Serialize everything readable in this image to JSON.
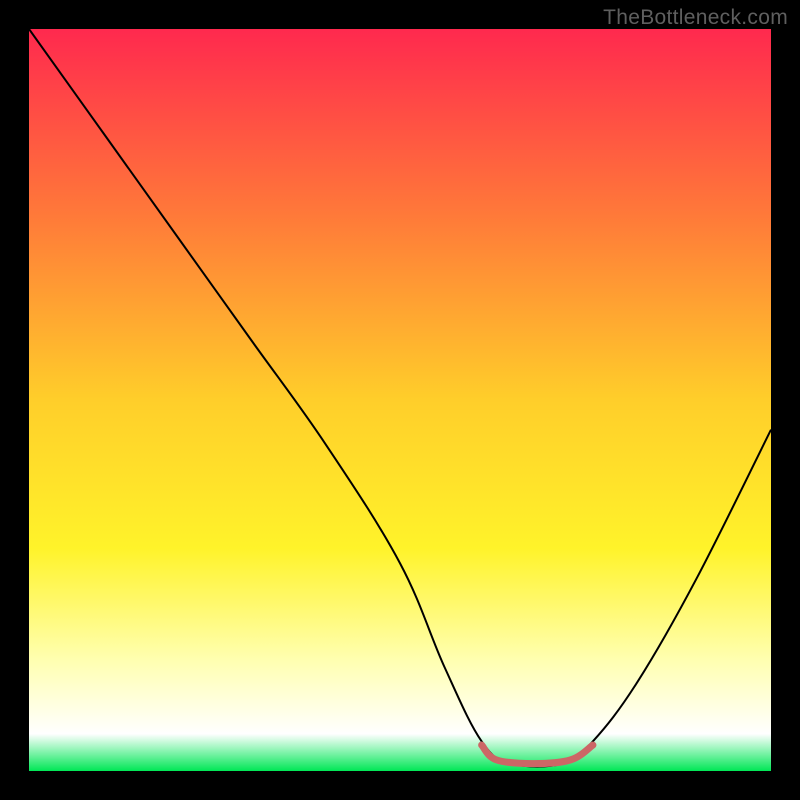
{
  "watermark": "TheBottleneck.com",
  "chart_data": {
    "type": "line",
    "title": "",
    "xlabel": "",
    "ylabel": "",
    "xlim": [
      0,
      100
    ],
    "ylim": [
      0,
      100
    ],
    "gradient_stops": [
      {
        "offset": 0,
        "color": "#ff294e"
      },
      {
        "offset": 0.25,
        "color": "#ff7939"
      },
      {
        "offset": 0.5,
        "color": "#ffce2a"
      },
      {
        "offset": 0.7,
        "color": "#fff32a"
      },
      {
        "offset": 0.85,
        "color": "#ffffb0"
      },
      {
        "offset": 0.95,
        "color": "#ffffff"
      },
      {
        "offset": 1.0,
        "color": "#00e756"
      }
    ],
    "series": [
      {
        "name": "bottleneck-curve",
        "stroke": "#000000",
        "stroke_width": 2,
        "points": [
          {
            "x": 0,
            "y": 100
          },
          {
            "x": 10,
            "y": 86
          },
          {
            "x": 20,
            "y": 72
          },
          {
            "x": 30,
            "y": 58
          },
          {
            "x": 40,
            "y": 44
          },
          {
            "x": 50,
            "y": 28
          },
          {
            "x": 56,
            "y": 14
          },
          {
            "x": 61,
            "y": 4
          },
          {
            "x": 65,
            "y": 1
          },
          {
            "x": 72,
            "y": 1
          },
          {
            "x": 76,
            "y": 4
          },
          {
            "x": 82,
            "y": 12
          },
          {
            "x": 90,
            "y": 26
          },
          {
            "x": 100,
            "y": 46
          }
        ]
      },
      {
        "name": "valley-floor-marker",
        "stroke": "#cc6666",
        "stroke_width": 7,
        "points": [
          {
            "x": 61,
            "y": 3.5
          },
          {
            "x": 63,
            "y": 1.5
          },
          {
            "x": 68,
            "y": 1.0
          },
          {
            "x": 73,
            "y": 1.5
          },
          {
            "x": 76,
            "y": 3.5
          }
        ]
      }
    ]
  }
}
